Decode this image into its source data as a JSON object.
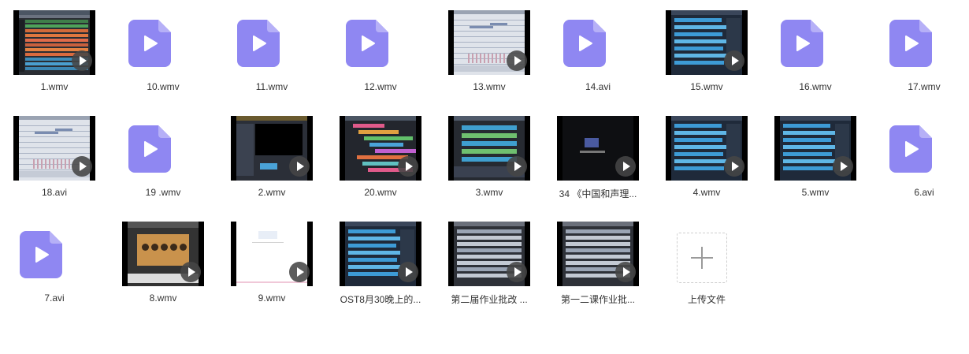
{
  "files": [
    {
      "name": "1.wmv",
      "kind": "video",
      "preview": "daw-orange"
    },
    {
      "name": "10.wmv",
      "kind": "file"
    },
    {
      "name": "11.wmv",
      "kind": "file"
    },
    {
      "name": "12.wmv",
      "kind": "file"
    },
    {
      "name": "13.wmv",
      "kind": "video",
      "preview": "score-light"
    },
    {
      "name": "14.avi",
      "kind": "file"
    },
    {
      "name": "15.wmv",
      "kind": "video",
      "preview": "daw-blue"
    },
    {
      "name": "16.wmv",
      "kind": "file"
    },
    {
      "name": "17.wmv",
      "kind": "file"
    },
    {
      "name": "18.avi",
      "kind": "video",
      "preview": "score-light"
    },
    {
      "name": "19 .wmv",
      "kind": "file"
    },
    {
      "name": "2.wmv",
      "kind": "video",
      "preview": "daw-dark"
    },
    {
      "name": "20.wmv",
      "kind": "video",
      "preview": "daw-multi"
    },
    {
      "name": "3.wmv",
      "kind": "video",
      "preview": "daw-green"
    },
    {
      "name": "34 《中国和声理...",
      "kind": "video",
      "preview": "dark-title"
    },
    {
      "name": "4.wmv",
      "kind": "video",
      "preview": "daw-blue"
    },
    {
      "name": "5.wmv",
      "kind": "video",
      "preview": "daw-blue"
    },
    {
      "name": "6.avi",
      "kind": "file"
    },
    {
      "name": "7.avi",
      "kind": "file"
    },
    {
      "name": "8.wmv",
      "kind": "video",
      "preview": "plugin"
    },
    {
      "name": "9.wmv",
      "kind": "video",
      "preview": "white-doc"
    },
    {
      "name": "OST8月30晚上的...",
      "kind": "video",
      "preview": "daw-blue"
    },
    {
      "name": "第二届作业批改 ...",
      "kind": "video",
      "preview": "daw-grey"
    },
    {
      "name": "第一二课作业批...",
      "kind": "video",
      "preview": "daw-grey"
    }
  ],
  "upload": {
    "label": "上传文件"
  },
  "colors": {
    "file_icon": "#8f87f2",
    "file_icon_fold": "#b6b0f7",
    "caption": "#333333"
  }
}
